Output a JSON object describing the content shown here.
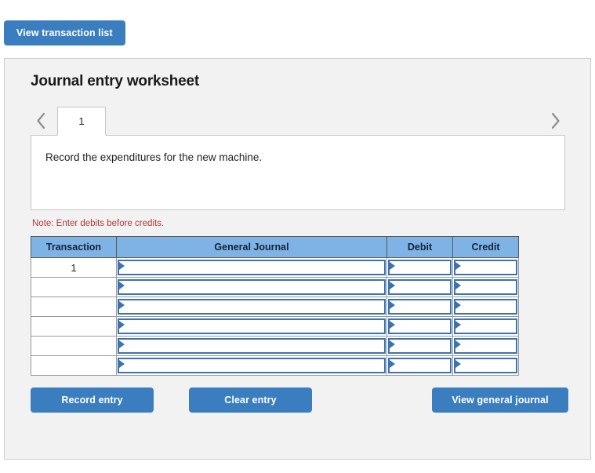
{
  "top": {
    "view_transaction_list_label": "View transaction list"
  },
  "panel": {
    "title": "Journal entry worksheet",
    "tabs": [
      {
        "label": "1",
        "active": true
      }
    ],
    "nav": {
      "prev_icon": "chevron-left-icon",
      "next_icon": "chevron-right-icon"
    },
    "description": "Record the expenditures for the new machine.",
    "note": "Note: Enter debits before credits.",
    "table": {
      "columns": [
        "Transaction",
        "General Journal",
        "Debit",
        "Credit"
      ],
      "rows": [
        {
          "transaction": "1",
          "general_journal": "",
          "debit": "",
          "credit": ""
        },
        {
          "transaction": "",
          "general_journal": "",
          "debit": "",
          "credit": ""
        },
        {
          "transaction": "",
          "general_journal": "",
          "debit": "",
          "credit": ""
        },
        {
          "transaction": "",
          "general_journal": "",
          "debit": "",
          "credit": ""
        },
        {
          "transaction": "",
          "general_journal": "",
          "debit": "",
          "credit": ""
        },
        {
          "transaction": "",
          "general_journal": "",
          "debit": "",
          "credit": ""
        }
      ]
    },
    "actions": {
      "record_entry_label": "Record entry",
      "clear_entry_label": "Clear entry",
      "view_general_journal_label": "View general journal"
    }
  },
  "colors": {
    "button_blue": "#3b7ebf",
    "header_blue": "#7fb2e5",
    "input_border_blue": "#3b72b0",
    "note_red": "#b03a3a",
    "panel_gray": "#f2f2f2"
  }
}
